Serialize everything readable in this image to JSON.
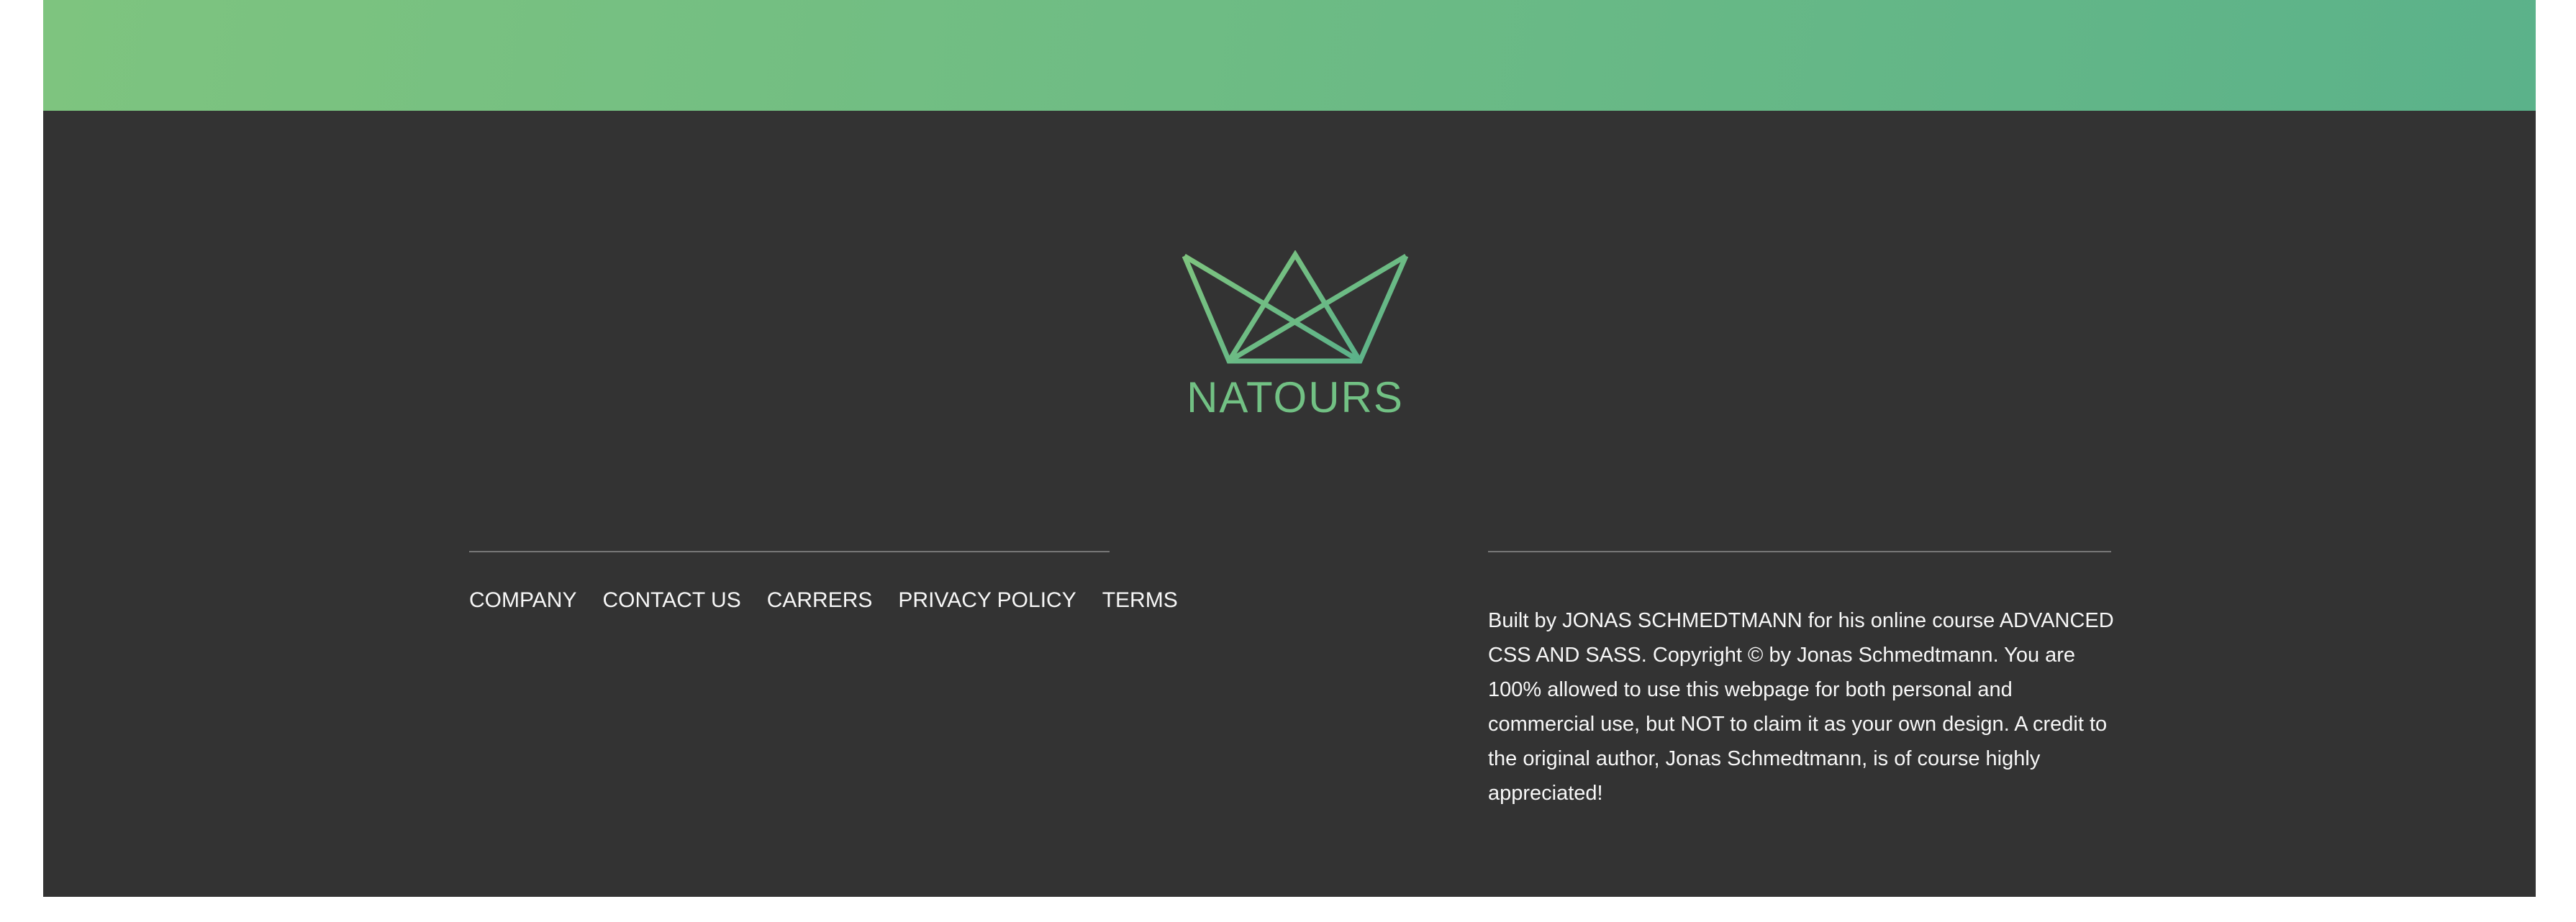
{
  "brand": {
    "name": "NATOURS",
    "gradient_start": "#7ec47f",
    "gradient_end": "#5bb28a",
    "footer_background": "#333333"
  },
  "nav": {
    "items": [
      {
        "label": "COMPANY"
      },
      {
        "label": "CONTACT US"
      },
      {
        "label": "CARRERS"
      },
      {
        "label": "PRIVACY POLICY"
      },
      {
        "label": "TERMS"
      }
    ]
  },
  "footer": {
    "copyright": "Built by JONAS SCHMEDTMANN for his online course ADVANCED CSS AND SASS. Copyright © by Jonas Schmedtmann. You are 100% allowed to use this webpage for both personal and commercial use, but NOT to claim it as your own design. A credit to the original author, Jonas Schmedtmann, is of course highly appreciated!"
  }
}
